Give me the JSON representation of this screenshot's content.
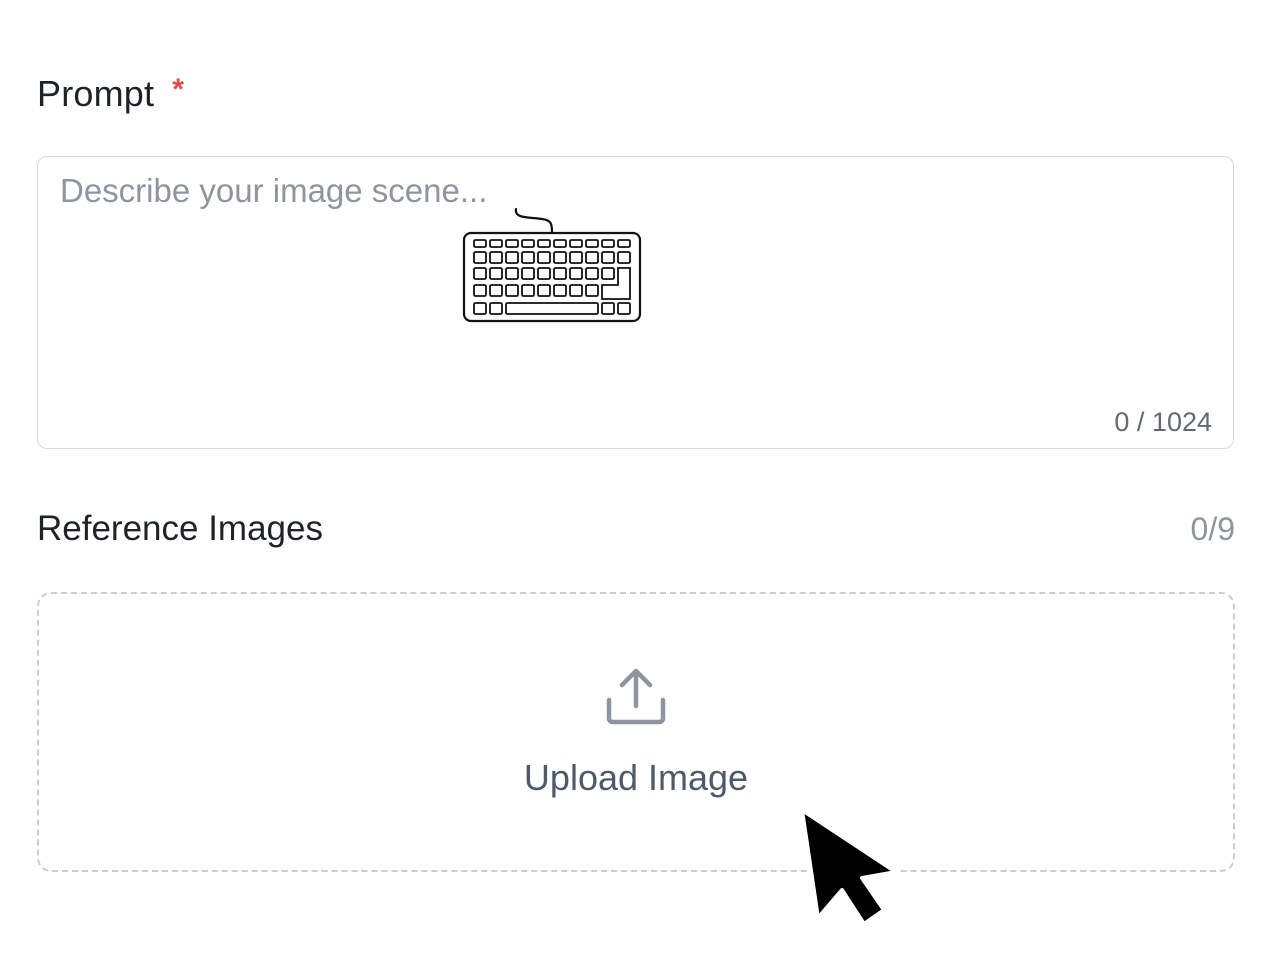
{
  "prompt": {
    "label": "Prompt",
    "required_mark": "*",
    "placeholder": "Describe your image scene...",
    "value": "",
    "counter": "0 / 1024"
  },
  "reference_images": {
    "label": "Reference Images",
    "count": "0/9",
    "upload_label": "Upload Image"
  },
  "icons": {
    "keyboard": "keyboard-icon",
    "upload": "upload-icon",
    "cursor": "mouse-pointer-icon"
  },
  "colors": {
    "required": "#e5484d",
    "text": "#1f2329",
    "placeholder": "#8f959e",
    "border": "#d6d9de",
    "dashed_border": "#c9cdd4",
    "upload_text": "#4e5969"
  }
}
